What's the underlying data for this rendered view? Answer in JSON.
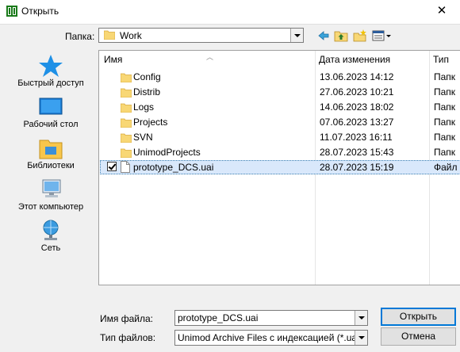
{
  "window": {
    "title": "Открыть",
    "close_glyph": "✕"
  },
  "lookin": {
    "label": "Папка:",
    "value": "Work"
  },
  "toolbar": {
    "icons": [
      "back-arrow-icon",
      "up-folder-icon",
      "new-folder-icon",
      "view-menu-icon"
    ]
  },
  "places": [
    {
      "label": "Быстрый доступ",
      "icon": "quick-access-star-icon"
    },
    {
      "label": "Рабочий стол",
      "icon": "desktop-icon"
    },
    {
      "label": "Библиотеки",
      "icon": "libraries-icon"
    },
    {
      "label": "Этот компьютер",
      "icon": "computer-icon"
    },
    {
      "label": "Сеть",
      "icon": "network-icon"
    }
  ],
  "filelist": {
    "columns": {
      "name": "Имя",
      "date": "Дата изменения",
      "type": "Тип"
    },
    "rows": [
      {
        "name": "Config",
        "date": "13.06.2023 14:12",
        "type": "Папк",
        "kind": "folder"
      },
      {
        "name": "Distrib",
        "date": "27.06.2023 10:21",
        "type": "Папк",
        "kind": "folder"
      },
      {
        "name": "Logs",
        "date": "14.06.2023 18:02",
        "type": "Папк",
        "kind": "folder"
      },
      {
        "name": "Projects",
        "date": "07.06.2023 13:27",
        "type": "Папк",
        "kind": "folder"
      },
      {
        "name": "SVN",
        "date": "11.07.2023 16:11",
        "type": "Папк",
        "kind": "folder"
      },
      {
        "name": "UnimodProjects",
        "date": "28.07.2023 15:43",
        "type": "Папк",
        "kind": "folder"
      },
      {
        "name": "prototype_DCS.uai",
        "date": "28.07.2023 15:19",
        "type": "Файл",
        "kind": "file",
        "selected": true,
        "checked": true
      }
    ]
  },
  "bottom": {
    "filename_label": "Имя файла:",
    "filename_value": "prototype_DCS.uai",
    "filetype_label": "Тип файлов:",
    "filetype_value": "Unimod Archive Files с индексацией (*.uai)",
    "open_label": "Открыть",
    "cancel_label": "Отмена"
  }
}
